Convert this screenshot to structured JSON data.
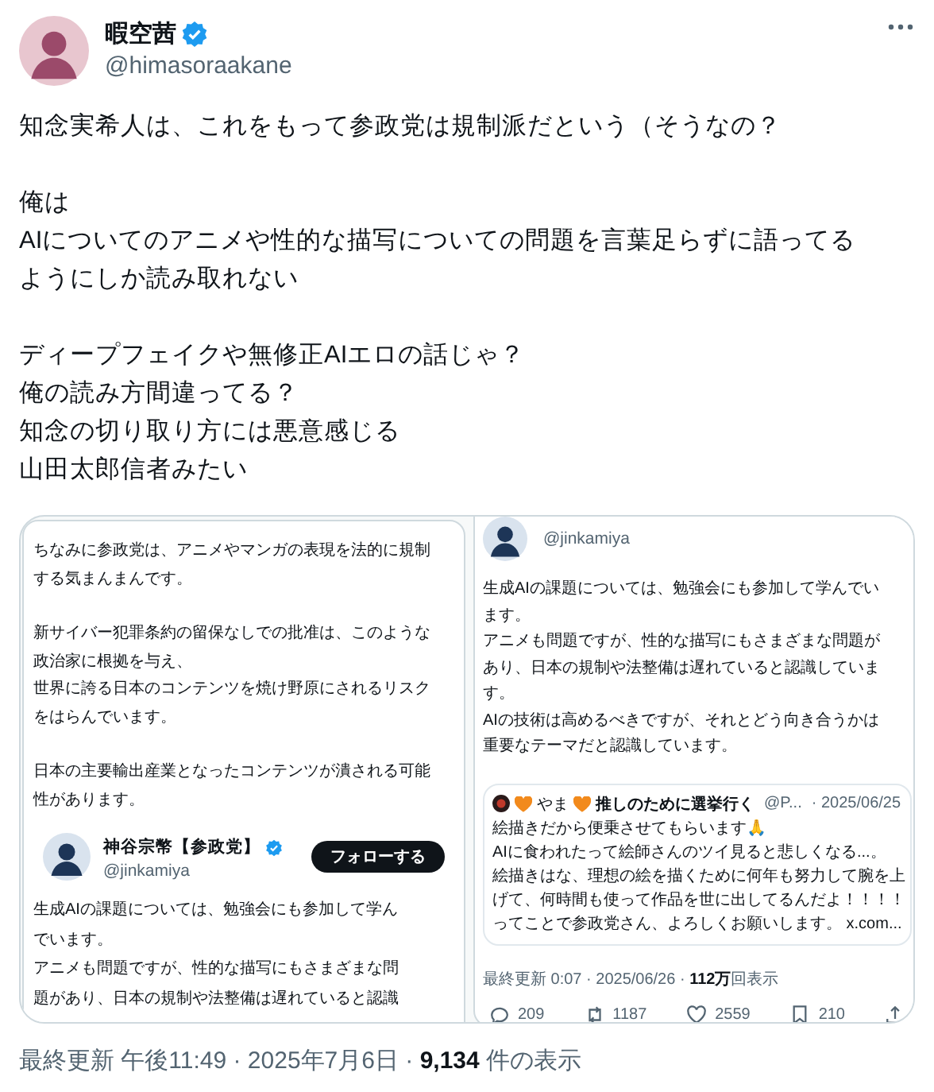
{
  "author": {
    "name": "暇空茜",
    "verified": true,
    "handle": "@himasoraakane"
  },
  "post_text": [
    [
      "知念実希人は、これをもって参政党は規制派だという（そうなの？"
    ],
    [
      "俺は",
      "AIについてのアニメや性的な描写についての問題を言葉足らずに語ってる",
      "ようにしか読み取れない"
    ],
    [
      "ディープフェイクや無修正AIエロの話じゃ？",
      "俺の読み方間違ってる？",
      "知念の切り取り方には悪意感じる",
      "山田太郎信者みたい"
    ]
  ],
  "image": {
    "left_panel": {
      "text": [
        [
          "ちなみに参政党は、アニメやマンガの表現を法的に規制",
          "する気まんまんです。"
        ],
        [
          "新サイバー犯罪条約の留保なしでの批准は、このような",
          "政治家に根拠を与え、",
          "世界に誇る日本のコンテンツを焼け野原にされるリスク",
          "をはらんでいます。"
        ],
        [
          "日本の主要輸出産業となったコンテンツが潰される可能",
          "性があります。"
        ]
      ],
      "quoted_post": {
        "name": "神谷宗幣【参政党】",
        "verified": true,
        "handle": "@jinkamiya",
        "follow_button": "フォローする",
        "text": [
          [
            "生成AIの課題については、勉強会にも参加して学ん",
            "でいます。",
            "アニメも問題ですが、性的な描写にもさまざまな問",
            "題があり、日本の規制や法整備は遅れていると認識"
          ]
        ]
      }
    },
    "right_panel": {
      "handle": "@jinkamiya",
      "text": [
        [
          "生成AIの課題については、勉強会にも参加して学んでい",
          "ます。",
          "アニメも問題ですが、性的な描写にもさまざまな問題が",
          "あり、日本の規制や法整備は遅れていると認識していま",
          "す。",
          "AIの技術は高めるべきですが、それとどう向き合うかは",
          "重要なテーマだと認識しています。"
        ]
      ],
      "quoted_post": {
        "name": "やま",
        "tagline": "推しのために選挙行く",
        "handle": "@P...",
        "date": "· 2025/06/25",
        "text": [
          [
            "絵描きだから便乗させてもらいます🙏",
            "AIに食われたって絵師さんのツイ見ると悲しくなる...。",
            "絵描きはな、理想の絵を描くために何年も努力して腕を上",
            "げて、何時間も使って作品を世に出してるんだよ！！！！",
            "ってことで参政党さん、よろしくお願いします。 x.com..."
          ]
        ]
      },
      "meta": "最終更新 0:07 · 2025/06/26 · **112万**回表示",
      "actions": [
        {
          "kind": "reply",
          "count": "209"
        },
        {
          "kind": "repost",
          "count": "1187"
        },
        {
          "kind": "like",
          "count": "2559"
        },
        {
          "kind": "bookmark",
          "count": "210"
        },
        {
          "kind": "share"
        }
      ]
    }
  },
  "footer": "最終更新 午後11:49 · 2025年7月6日 · **9,134** 件の表示"
}
